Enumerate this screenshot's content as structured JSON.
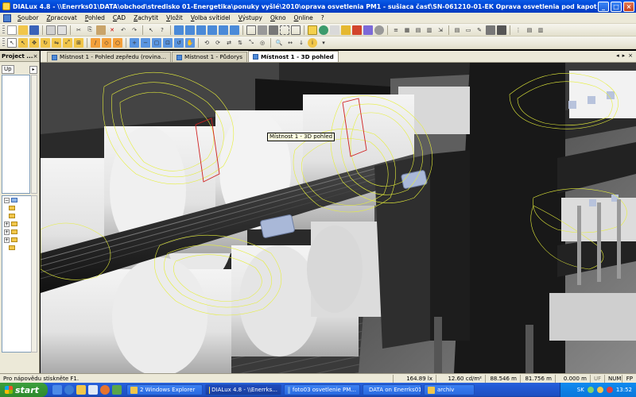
{
  "window": {
    "title": "DIALux 4.8 - \\\\Enerrks01\\DATA\\obchod\\stredisko 01-Energetika\\ponuky vyšlé\\2010\\oprava osvetlenia PM1 - sušiaca časť\\SN-061210-01-EK Oprava osvetlenia pod kapot",
    "minimize": "_",
    "maximize": "□",
    "close": "×"
  },
  "menu": [
    "Soubor",
    "Zpracovat",
    "Pohled",
    "CAD",
    "Zachytit",
    "Vložit",
    "Volba svítidel",
    "Výstupy",
    "Okno",
    "Online",
    "?"
  ],
  "project_panel": {
    "title": "Project ...",
    "pin": "×",
    "up_label": "Up"
  },
  "doc_tabs": [
    {
      "label": "Místnost 1 - Pohled zepředu (rovina...",
      "active": false
    },
    {
      "label": "Místnost 1 - Půdorys",
      "active": false
    },
    {
      "label": "Místnost 1 - 3D pohled",
      "active": true
    }
  ],
  "tooltip": "Místnost 1 - 3D pohled",
  "status": {
    "help": "Pro nápovědu stiskněte F1.",
    "coord1": "164.89 lx",
    "luminance": "12.60 cd/m²",
    "coord2": "88.546 m",
    "coord3": "81.756 m",
    "height": "0.000 m",
    "flags": [
      "UF",
      "NUM",
      "FP"
    ]
  },
  "taskbar": {
    "start": "start",
    "tasks": [
      {
        "label": "2 Windows Explorer",
        "active": false,
        "color": "#f1c64a"
      },
      {
        "label": "DIALux 4.8 - \\\\Enerrks...",
        "active": true,
        "color": "#ffd84a"
      },
      {
        "label": "foto03 osvetlenie PM...",
        "active": false,
        "color": "#6aa2e8"
      },
      {
        "label": "DATA on Enerrks01",
        "active": false,
        "color": "#f1c64a"
      },
      {
        "label": "archiv",
        "active": false,
        "color": "#f1c64a"
      }
    ],
    "lang": "SK",
    "clock": "13:52"
  }
}
